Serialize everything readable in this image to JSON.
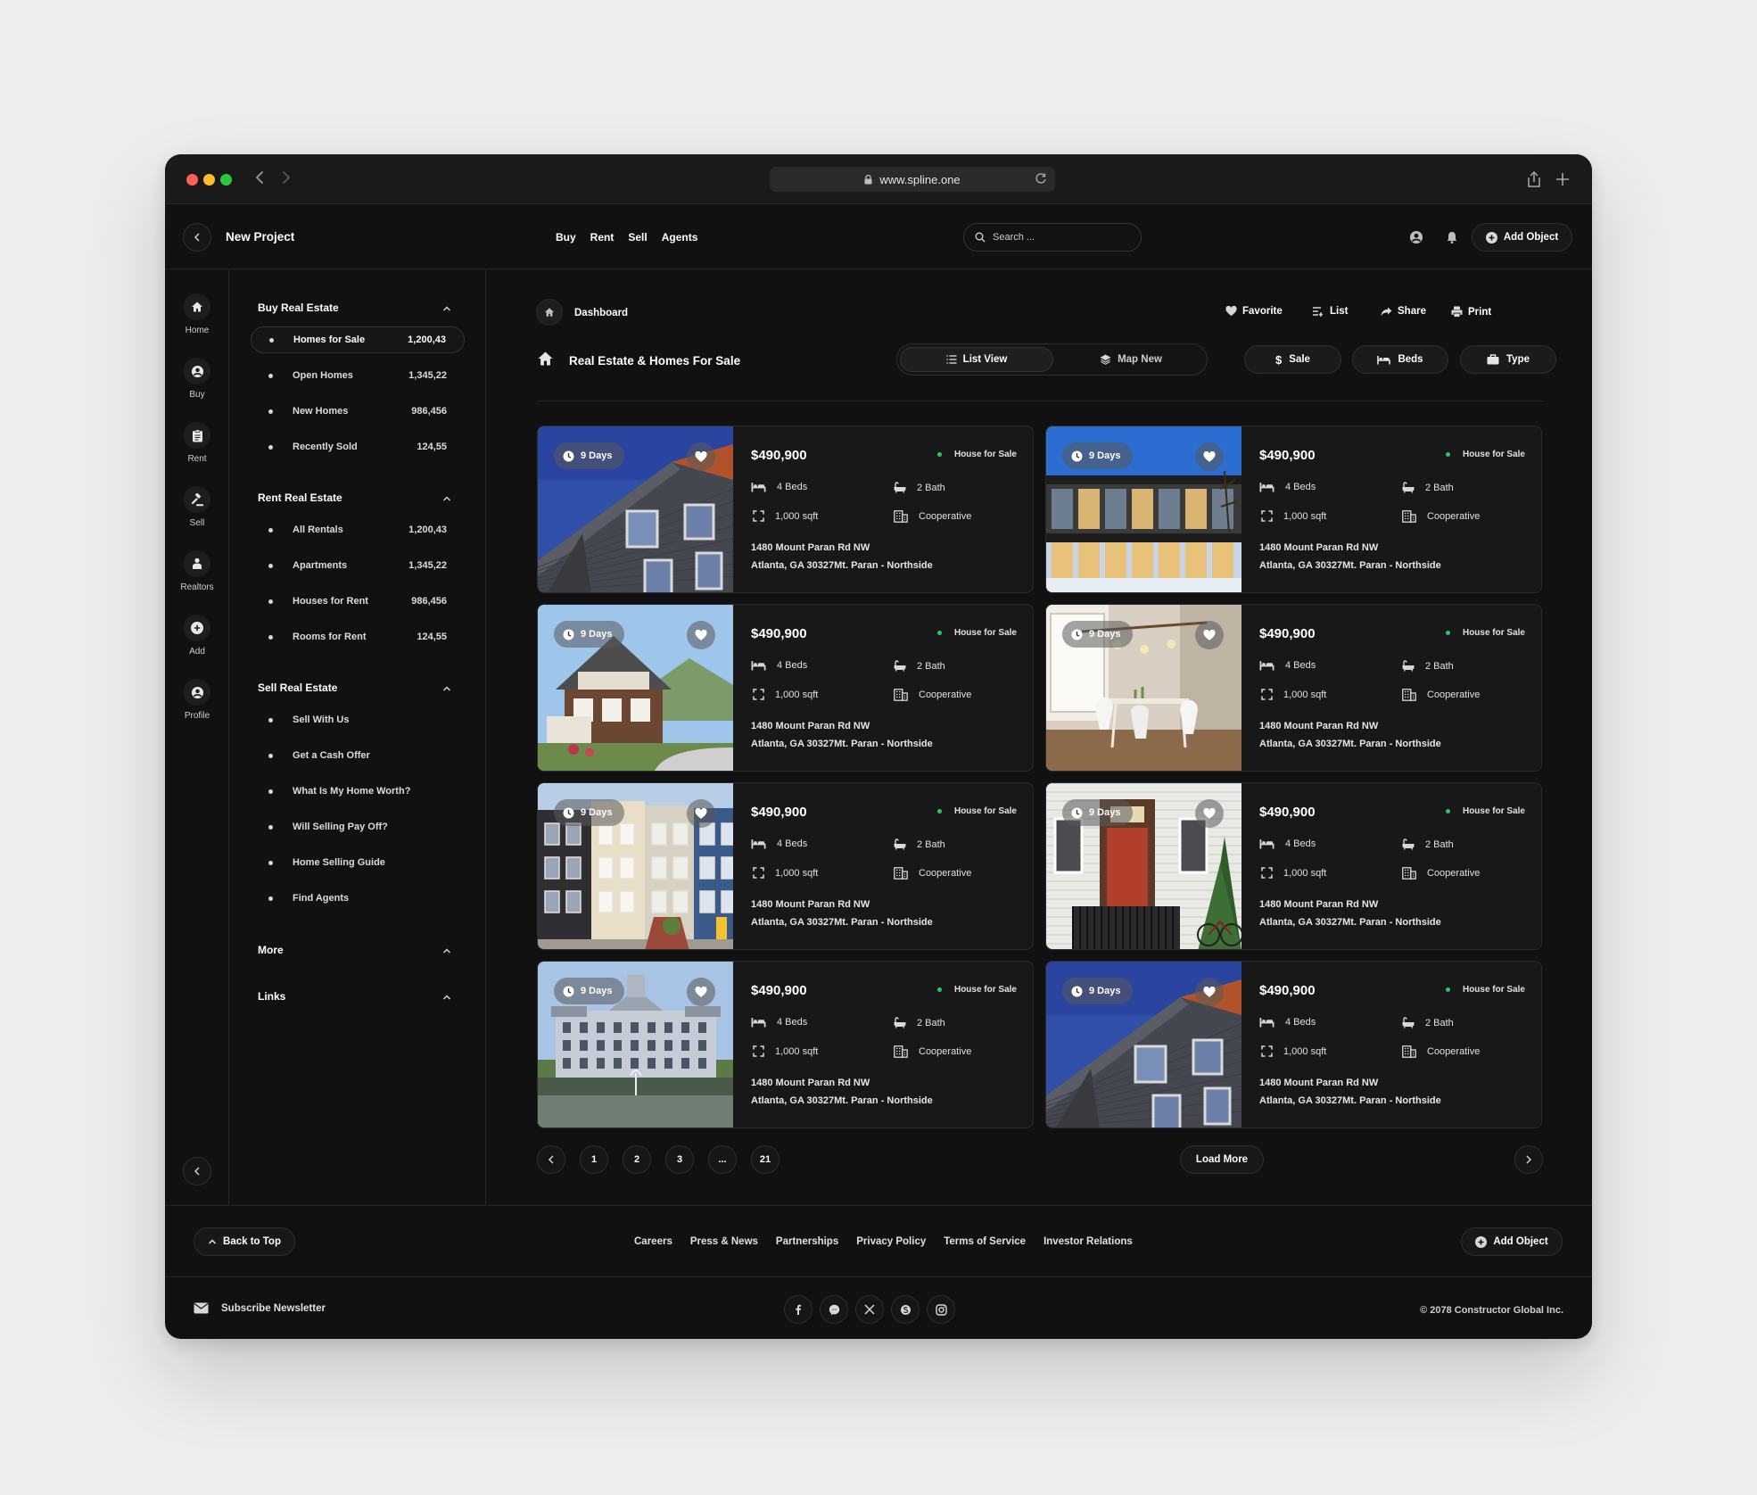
{
  "browser": {
    "url": "www.spline.one",
    "traffic_colors": [
      "#ff5f57",
      "#febc2e",
      "#28c840"
    ]
  },
  "header": {
    "project_title": "New Project",
    "nav": [
      "Buy",
      "Rent",
      "Sell",
      "Agents"
    ],
    "search_placeholder": "Search ...",
    "add_object": "Add Object"
  },
  "rail": [
    {
      "label": "Home",
      "icon": "home-icon"
    },
    {
      "label": "Buy",
      "icon": "user-circle-icon"
    },
    {
      "label": "Rent",
      "icon": "clipboard-icon"
    },
    {
      "label": "Sell",
      "icon": "gavel-icon"
    },
    {
      "label": "Realtors",
      "icon": "person-icon"
    },
    {
      "label": "Add",
      "icon": "plus-circle-icon"
    },
    {
      "label": "Profile",
      "icon": "user-circle-icon"
    }
  ],
  "sidebar": {
    "sections": [
      {
        "title": "Buy Real Estate",
        "items": [
          {
            "label": "Homes for Sale",
            "count": "1,200,43",
            "active": true
          },
          {
            "label": "Open Homes",
            "count": "1,345,22"
          },
          {
            "label": "New Homes",
            "count": "986,456"
          },
          {
            "label": "Recently Sold",
            "count": "124,55"
          }
        ]
      },
      {
        "title": "Rent Real Estate",
        "items": [
          {
            "label": "All Rentals",
            "count": "1,200,43"
          },
          {
            "label": "Apartments",
            "count": "1,345,22"
          },
          {
            "label": "Houses for Rent",
            "count": "986,456"
          },
          {
            "label": "Rooms for Rent",
            "count": "124,55"
          }
        ]
      },
      {
        "title": "Sell Real Estate",
        "items": [
          {
            "label": "Sell With Us"
          },
          {
            "label": "Get a Cash Offer"
          },
          {
            "label": "What Is My Home Worth?"
          },
          {
            "label": "Will Selling Pay Off?"
          },
          {
            "label": "Home Selling Guide"
          },
          {
            "label": "Find Agents"
          }
        ]
      },
      {
        "title": "More",
        "items": []
      },
      {
        "title": "Links",
        "items": []
      }
    ]
  },
  "main": {
    "breadcrumb": "Dashboard",
    "actions": [
      "Favorite",
      "List",
      "Share",
      "Print"
    ],
    "title": "Real Estate & Homes For Sale",
    "views": [
      "List View",
      "Map New"
    ],
    "filters": [
      "Sale",
      "Beds",
      "Type"
    ],
    "card_template": {
      "days": "9 Days",
      "price": "$490,900",
      "status": "House for Sale",
      "beds": "4 Beds",
      "bath": "2 Bath",
      "area": "1,000 sqft",
      "kind": "Cooperative",
      "address1": "1480 Mount Paran Rd NW",
      "address2": "Atlanta, GA 30327Mt. Paran - Northside"
    },
    "listing_count": 8,
    "pages": [
      "1",
      "2",
      "3",
      "...",
      "21"
    ],
    "load_more": "Load More"
  },
  "footer": {
    "back_to_top": "Back to Top",
    "links": [
      "Careers",
      "Press & News",
      "Partnerships",
      "Privacy Policy",
      "Terms of Service",
      "Investor Relations"
    ],
    "add_object": "Add Object",
    "newsletter": "Subscribe Newsletter",
    "socials": [
      "facebook-icon",
      "messenger-icon",
      "x-icon",
      "skype-icon",
      "instagram-icon"
    ],
    "copyright": "© 2078 Constructor Global Inc."
  },
  "colors": {
    "status_dot": "#2bc46a",
    "surface": "#111111",
    "card": "#181818"
  }
}
